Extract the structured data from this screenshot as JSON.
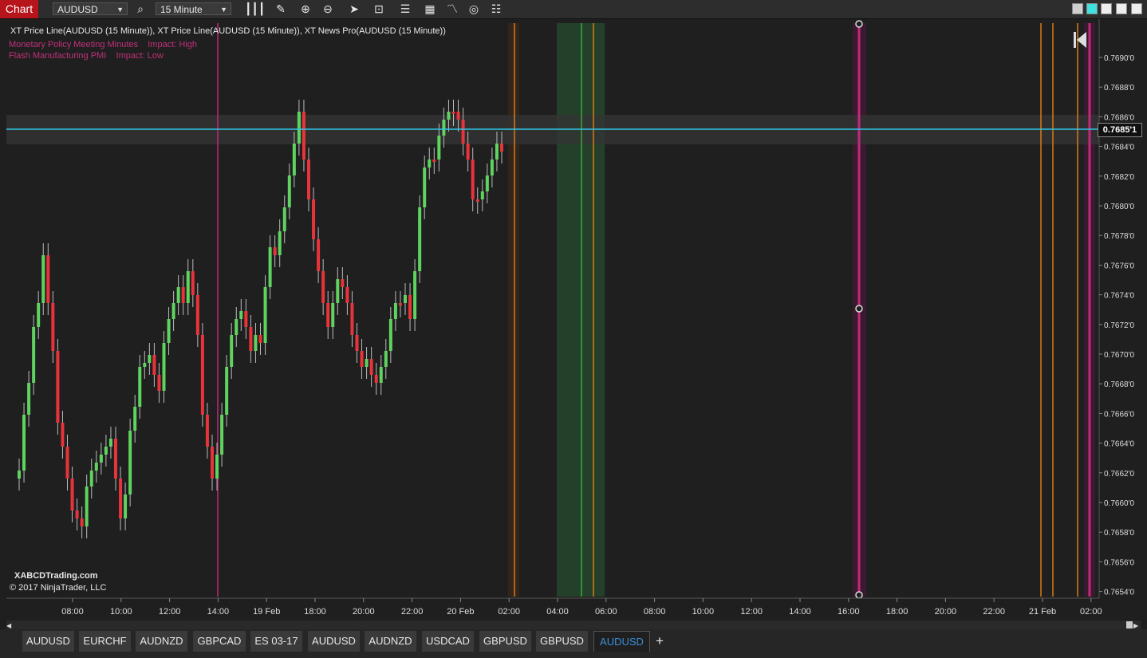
{
  "toolbar": {
    "chart_label": "Chart",
    "instrument": "AUDUSD",
    "interval": "15 Minute"
  },
  "legend": {
    "indicators": "XT Price Line(AUDUSD (15 Minute)), XT Price Line(AUDUSD (15 Minute)), XT News Pro(AUDUSD (15 Minute))",
    "news": [
      {
        "event": "Monetary Policy Meeting Minutes",
        "impact": "Impact: High"
      },
      {
        "event": "Flash Manufacturing PMI",
        "impact": "Impact: Low"
      }
    ]
  },
  "watermark": {
    "site": "XABCDTrading.com",
    "copyright": "© 2017 NinjaTrader, LLC"
  },
  "price_axis": {
    "labels": [
      "0.7690'0",
      "0.7688'0",
      "0.7686'0",
      "0.7684'0",
      "0.7682'0",
      "0.7680'0",
      "0.7678'0",
      "0.7676'0",
      "0.7674'0",
      "0.7672'0",
      "0.7670'0",
      "0.7668'0",
      "0.7666'0",
      "0.7664'0",
      "0.7662'0",
      "0.7660'0",
      "0.7658'0",
      "0.7656'0",
      "0.7654'0"
    ],
    "current_price": "0.7685'1"
  },
  "time_axis": {
    "labels": [
      "08:00",
      "10:00",
      "12:00",
      "14:00",
      "19 Feb",
      "18:00",
      "20:00",
      "22:00",
      "20 Feb",
      "02:00",
      "04:00",
      "06:00",
      "08:00",
      "10:00",
      "12:00",
      "14:00",
      "16:00",
      "18:00",
      "20:00",
      "22:00",
      "21 Feb",
      "02:00"
    ]
  },
  "colors": {
    "up_candle": "#5fd35f",
    "down_candle": "#e8333a",
    "price_line": "#2fc8e8",
    "news_high": "#c2297a",
    "news_orange": "#d97a18",
    "session_green": "#2d5a2d"
  },
  "symbol_tabs": [
    "AUDUSD",
    "EURCHF",
    "AUDNZD",
    "GBPCAD",
    "ES 03-17",
    "AUDUSD",
    "AUDNZD",
    "USDCAD",
    "GBPUSD",
    "GBPUSD",
    "AUDUSD"
  ],
  "active_tab_index": 10,
  "add_tab": "+"
}
